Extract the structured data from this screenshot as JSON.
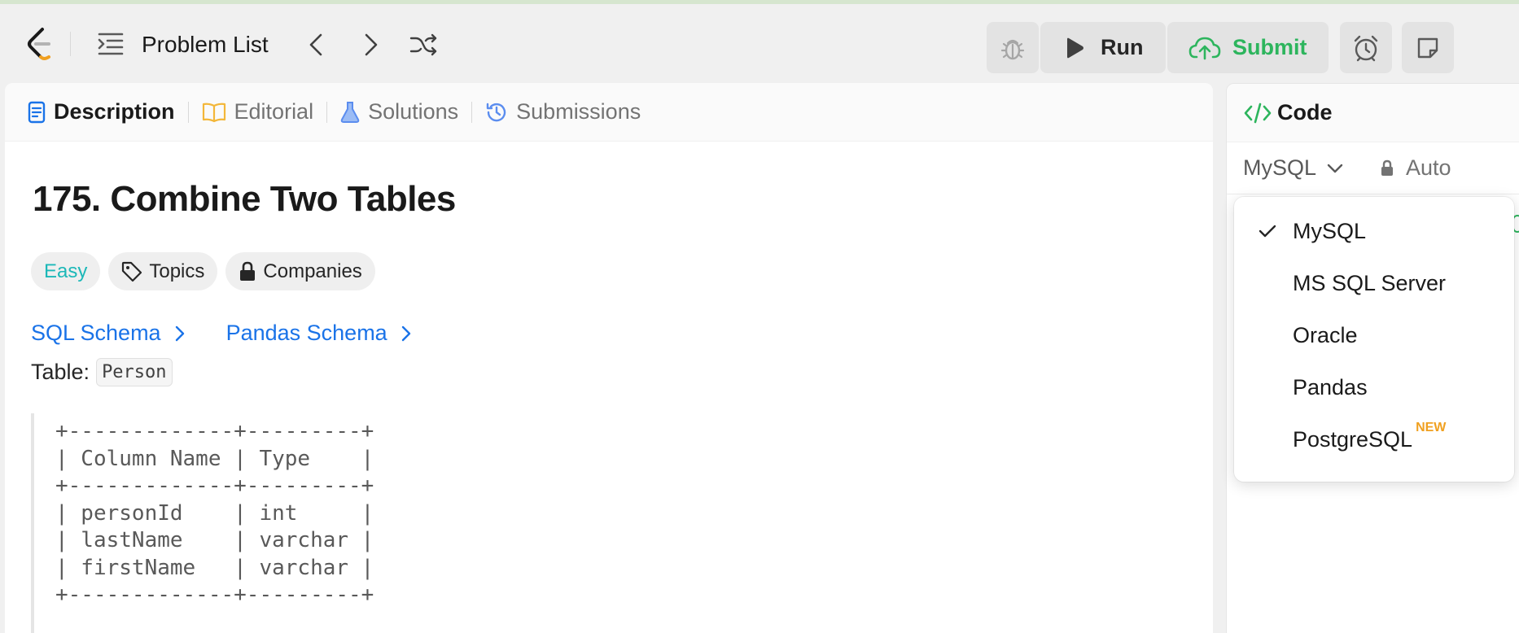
{
  "topbar": {
    "problem_list_label": "Problem List",
    "run_label": "Run",
    "submit_label": "Submit"
  },
  "tabs": [
    {
      "label": "Description",
      "icon": "description-icon",
      "active": true
    },
    {
      "label": "Editorial",
      "icon": "book-icon",
      "active": false
    },
    {
      "label": "Solutions",
      "icon": "flask-icon",
      "active": false
    },
    {
      "label": "Submissions",
      "icon": "history-icon",
      "active": false
    }
  ],
  "problem": {
    "title": "175. Combine Two Tables",
    "difficulty": "Easy",
    "topics_label": "Topics",
    "companies_label": "Companies",
    "sql_schema_label": "SQL Schema",
    "pandas_schema_label": "Pandas Schema",
    "table_prefix": "Table:",
    "table_name": "Person",
    "schema_lines": [
      "+-------------+---------+",
      "| Column Name | Type    |",
      "+-------------+---------+",
      "| personId    | int     |",
      "| lastName    | varchar |",
      "| firstName   | varchar |",
      "+-------------+---------+"
    ]
  },
  "code_panel": {
    "header_label": "Code",
    "selected_language": "MySQL",
    "auto_label": "Auto",
    "language_options": [
      {
        "label": "MySQL",
        "selected": true,
        "badge": ""
      },
      {
        "label": "MS SQL Server",
        "selected": false,
        "badge": ""
      },
      {
        "label": "Oracle",
        "selected": false,
        "badge": ""
      },
      {
        "label": "Pandas",
        "selected": false,
        "badge": ""
      },
      {
        "label": "PostgreSQL",
        "selected": false,
        "badge": "NEW"
      }
    ]
  },
  "colors": {
    "accent_green": "#2db55d",
    "link_blue": "#1a73e8",
    "easy_teal": "#1cb8b8",
    "badge_orange": "#f0a020"
  }
}
